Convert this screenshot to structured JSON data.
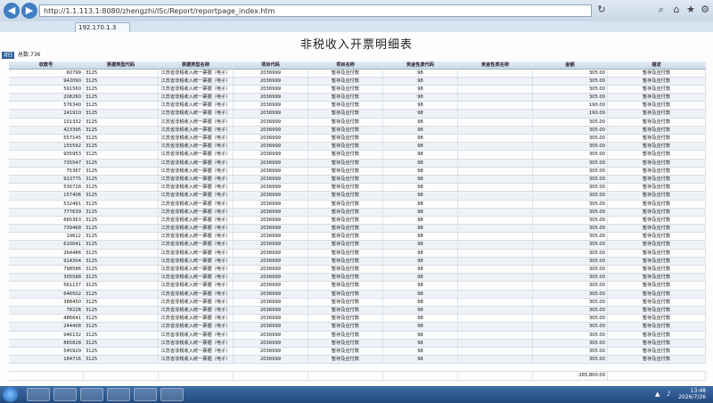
{
  "browser": {
    "address": "http://1.1.113.1:8080/zhengzhi/lSc/Report/reportpage_index.htm",
    "tab_title": "192.170.1.3"
  },
  "page": {
    "title": "非税收入开票明细表",
    "back_label": "返回",
    "total_label": "总数:736"
  },
  "table": {
    "headers": [
      "收款号",
      "票据类型代码",
      "票据类型名称",
      "项目代码",
      "项目名称",
      "资金性质代码",
      "资金性质名称",
      "金额",
      "描述"
    ],
    "rows": [
      [
        "60799",
        "3125",
        "江苏省非税收入统一票据（电子）",
        "2036999",
        "暂存及应付款",
        "98",
        "",
        "305.00",
        "暂存及应付款"
      ],
      [
        "942090",
        "3125",
        "江苏省非税收入统一票据（电子）",
        "2036999",
        "暂存及应付款",
        "98",
        "",
        "305.00",
        "暂存及应付款"
      ],
      [
        "591560",
        "3125",
        "江苏省非税收入统一票据（电子）",
        "2036999",
        "暂存及应付款",
        "98",
        "",
        "305.00",
        "暂存及应付款"
      ],
      [
        "208260",
        "3125",
        "江苏省非税收入统一票据（电子）",
        "2036999",
        "暂存及应付款",
        "98",
        "",
        "305.00",
        "暂存及应付款"
      ],
      [
        "576340",
        "3125",
        "江苏省非税收入统一票据（电子）",
        "2036999",
        "暂存及应付款",
        "98",
        "",
        "190.00",
        "暂存及应付款"
      ],
      [
        "241910",
        "3125",
        "江苏省非税收入统一票据（电子）",
        "2036999",
        "暂存及应付款",
        "98",
        "",
        "190.00",
        "暂存及应付款"
      ],
      [
        "101332",
        "3125",
        "江苏省非税收入统一票据（电子）",
        "2036999",
        "暂存及应付款",
        "98",
        "",
        "305.00",
        "暂存及应付款"
      ],
      [
        "423395",
        "3125",
        "江苏省非税收入统一票据（电子）",
        "2036999",
        "暂存及应付款",
        "98",
        "",
        "305.00",
        "暂存及应付款"
      ],
      [
        "557145",
        "3125",
        "江苏省非税收入统一票据（电子）",
        "2036999",
        "暂存及应付款",
        "98",
        "",
        "305.00",
        "暂存及应付款"
      ],
      [
        "155592",
        "3125",
        "江苏省非税收入统一票据（电子）",
        "2036999",
        "暂存及应付款",
        "98",
        "",
        "305.00",
        "暂存及应付款"
      ],
      [
        "935953",
        "3125",
        "江苏省非税收入统一票据（电子）",
        "2036999",
        "暂存及应付款",
        "98",
        "",
        "305.00",
        "暂存及应付款"
      ],
      [
        "735547",
        "3125",
        "江苏省非税收入统一票据（电子）",
        "2036999",
        "暂存及应付款",
        "98",
        "",
        "305.00",
        "暂存及应付款"
      ],
      [
        "75367",
        "3125",
        "江苏省非税收入统一票据（电子）",
        "2036999",
        "暂存及应付款",
        "98",
        "",
        "305.00",
        "暂存及应付款"
      ],
      [
        "913775",
        "3125",
        "江苏省非税收入统一票据（电子）",
        "2036999",
        "暂存及应付款",
        "98",
        "",
        "305.00",
        "暂存及应付款"
      ],
      [
        "530728",
        "3125",
        "江苏省非税收入统一票据（电子）",
        "2036999",
        "暂存及应付款",
        "98",
        "",
        "305.00",
        "暂存及应付款"
      ],
      [
        "157406",
        "3125",
        "江苏省非税收入统一票据（电子）",
        "2036999",
        "暂存及应付款",
        "98",
        "",
        "305.00",
        "暂存及应付款"
      ],
      [
        "532491",
        "3125",
        "江苏省非税收入统一票据（电子）",
        "2036999",
        "暂存及应付款",
        "98",
        "",
        "305.00",
        "暂存及应付款"
      ],
      [
        "777639",
        "3125",
        "江苏省非税收入统一票据（电子）",
        "2036999",
        "暂存及应付款",
        "98",
        "",
        "305.00",
        "暂存及应付款"
      ],
      [
        "665363",
        "3125",
        "江苏省非税收入统一票据（电子）",
        "2036999",
        "暂存及应付款",
        "98",
        "",
        "305.00",
        "暂存及应付款"
      ],
      [
        "739468",
        "3125",
        "江苏省非税收入统一票据（电子）",
        "2036999",
        "暂存及应付款",
        "98",
        "",
        "305.00",
        "暂存及应付款"
      ],
      [
        "19612",
        "3125",
        "江苏省非税收入统一票据（电子）",
        "2036999",
        "暂存及应付款",
        "98",
        "",
        "305.00",
        "暂存及应付款"
      ],
      [
        "610041",
        "3125",
        "江苏省非税收入统一票据（电子）",
        "2036999",
        "暂存及应付款",
        "98",
        "",
        "305.00",
        "暂存及应付款"
      ],
      [
        "264486",
        "3125",
        "江苏省非税收入统一票据（电子）",
        "2036999",
        "暂存及应付款",
        "98",
        "",
        "305.00",
        "暂存及应付款"
      ],
      [
        "914304",
        "3125",
        "江苏省非税收入统一票据（电子）",
        "2036999",
        "暂存及应付款",
        "98",
        "",
        "305.00",
        "暂存及应付款"
      ],
      [
        "798586",
        "3125",
        "江苏省非税收入统一票据（电子）",
        "2036999",
        "暂存及应付款",
        "98",
        "",
        "305.00",
        "暂存及应付款"
      ],
      [
        "305588",
        "3125",
        "江苏省非税收入统一票据（电子）",
        "2036999",
        "暂存及应付款",
        "98",
        "",
        "305.00",
        "暂存及应付款"
      ],
      [
        "561137",
        "3125",
        "江苏省非税收入统一票据（电子）",
        "2036999",
        "暂存及应付款",
        "98",
        "",
        "305.00",
        "暂存及应付款"
      ],
      [
        "646502",
        "3125",
        "江苏省非税收入统一票据（电子）",
        "2036999",
        "暂存及应付款",
        "98",
        "",
        "305.00",
        "暂存及应付款"
      ],
      [
        "388450",
        "3125",
        "江苏省非税收入统一票据（电子）",
        "2036999",
        "暂存及应付款",
        "98",
        "",
        "305.00",
        "暂存及应付款"
      ],
      [
        "78228",
        "3125",
        "江苏省非税收入统一票据（电子）",
        "2036999",
        "暂存及应付款",
        "98",
        "",
        "305.00",
        "暂存及应付款"
      ],
      [
        "486641",
        "3125",
        "江苏省非税收入统一票据（电子）",
        "2036999",
        "暂存及应付款",
        "98",
        "",
        "305.00",
        "暂存及应付款"
      ],
      [
        "244408",
        "3125",
        "江苏省非税收入统一票据（电子）",
        "2036999",
        "暂存及应付款",
        "98",
        "",
        "305.00",
        "暂存及应付款"
      ],
      [
        "946132",
        "3125",
        "江苏省非税收入统一票据（电子）",
        "2036999",
        "暂存及应付款",
        "98",
        "",
        "305.00",
        "暂存及应付款"
      ],
      [
        "865828",
        "3125",
        "江苏省非税收入统一票据（电子）",
        "2036999",
        "暂存及应付款",
        "98",
        "",
        "305.00",
        "暂存及应付款"
      ],
      [
        "545929",
        "3125",
        "江苏省非税收入统一票据（电子）",
        "2036999",
        "暂存及应付款",
        "98",
        "",
        "305.00",
        "暂存及应付款"
      ],
      [
        "184716",
        "3125",
        "江苏省非税收入统一票据（电子）",
        "2036999",
        "暂存及应付款",
        "98",
        "",
        "305.00",
        "暂存及应付款"
      ]
    ],
    "footer_total": "265,800.00"
  },
  "taskbar": {
    "time": "13:48",
    "date": "2026/7/26"
  }
}
